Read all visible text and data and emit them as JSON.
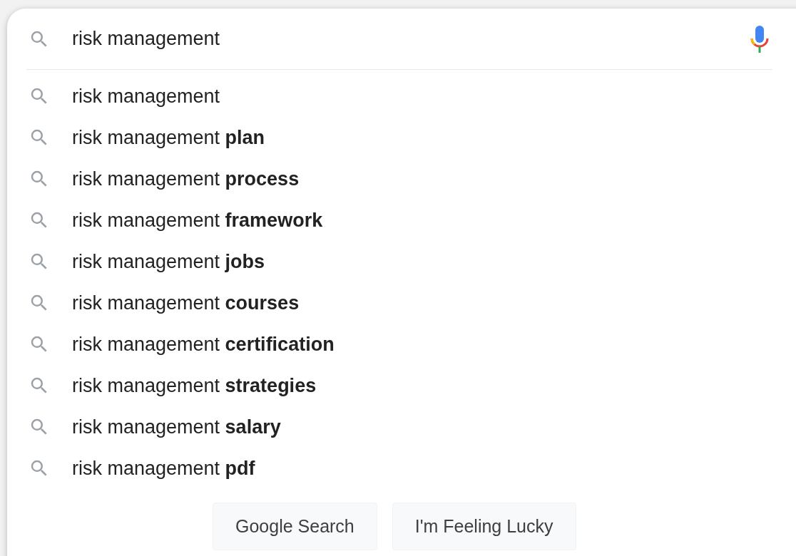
{
  "search": {
    "value": "risk management"
  },
  "suggestions": [
    {
      "text": "risk management"
    },
    {
      "text": "risk management **plan**"
    },
    {
      "text": "risk management **process**"
    },
    {
      "text": "risk management **framework**"
    },
    {
      "text": "risk management **jobs**"
    },
    {
      "text": "risk management **courses**"
    },
    {
      "text": "risk management **certification**"
    },
    {
      "text": "risk management **strategies**"
    },
    {
      "text": "risk management **salary**"
    },
    {
      "text": "risk management **pdf**"
    }
  ],
  "buttons": [
    "Google Search",
    "I'm Feeling Lucky"
  ]
}
